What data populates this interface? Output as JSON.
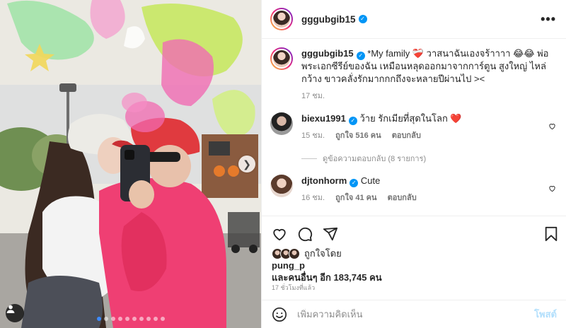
{
  "post": {
    "username": "gggubgib15",
    "more_label": "•••",
    "caption": {
      "username": "gggubgib15",
      "text": "*My family ❤️‍🩹 วาสนาฉันเองจร้าาาา 😂😂 พ่อพระเอกซีรีย์ของฉัน เหมือนหลุดออกมาจากการ์ตูน สูงใหญ่ ไหล่กว้าง ขาวคลั่งรักมากกกถึงจะหลายปีผ่านไป ><",
      "time": "17 ชม."
    },
    "comments": [
      {
        "username": "biexu1991",
        "text": "ว้าย รักเมียที่สุดในโลก ❤️",
        "time": "15 ชม.",
        "likes": "ถูกใจ 516 คน",
        "reply": "ตอบกลับ"
      },
      {
        "username": "djtonhorm",
        "text": "Cute",
        "time": "16 ชม.",
        "likes": "ถูกใจ 41 คน",
        "reply": "ตอบกลับ"
      }
    ],
    "view_replies": "ดูข้อความตอบกลับ (8 รายการ)",
    "liked_by_label": "ถูกใจโดย",
    "liked_by_user": "pung_p",
    "liked_by_others": "และคนอื่นๆ อีก 183,745 คน",
    "time_ago": "17 ชั่วโมงที่แล้ว",
    "add_comment_placeholder": "เพิ่มความคิดเห็น",
    "post_button": "โพสต์"
  },
  "icons": {
    "heart": "heart-icon",
    "comment": "comment-icon",
    "share": "paper-plane-icon",
    "save": "bookmark-icon",
    "emoji": "smiley-icon",
    "tag": "person-tag-icon",
    "next": "chevron-right-icon",
    "verified": "verified-badge-icon"
  },
  "colors": {
    "accent": "#0095f6",
    "post_button_disabled": "#b2dffc",
    "active_dot": "#3d8bfd",
    "secondary_text": "#8e8e8e"
  },
  "carousel": {
    "total": 10,
    "active": 1
  }
}
